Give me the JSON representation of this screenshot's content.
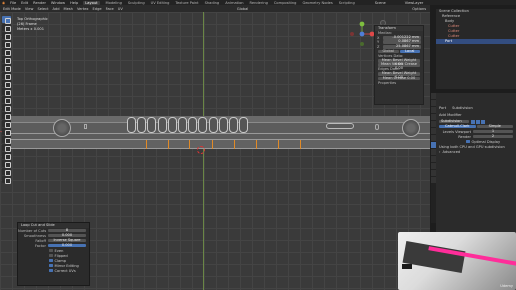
{
  "menubar": {
    "app_icon": "blender-logo-icon",
    "menus": [
      "File",
      "Edit",
      "Render",
      "Window",
      "Help"
    ],
    "workspaces": [
      "Layout",
      "Modeling",
      "Sculpting",
      "UV Editing",
      "Texture Paint",
      "Shading",
      "Animation",
      "Rendering",
      "Compositing",
      "Geometry Nodes",
      "Scripting"
    ],
    "active_workspace": "Layout",
    "scene": "Scene",
    "view_layer": "ViewLayer"
  },
  "header": {
    "mode": "Edit Mode",
    "items": [
      "View",
      "Select",
      "Add",
      "Mesh",
      "Vertex",
      "Edge",
      "Face",
      "UV"
    ],
    "transform": "Global",
    "overlay_label": "Options"
  },
  "viewport": {
    "info_lines": [
      "Top Orthographic",
      "(26) Frame",
      "Meters x 0.001"
    ],
    "gizmo": {
      "x_color": "#e04848",
      "y_color": "#7fbf3f",
      "z_color": "#4f7fd9"
    }
  },
  "npanel": {
    "title": "Transform",
    "section": "Median:",
    "rows": [
      {
        "label": "X",
        "value": "-0.001222 mm"
      },
      {
        "label": "Y",
        "value": "0.0867 mm"
      },
      {
        "label": "Z",
        "value": "25.0867 mm"
      }
    ],
    "space_buttons": [
      "Global",
      "Local"
    ],
    "active_space": "Local",
    "vertices_data": "Vertices Data:",
    "vertex_rows": [
      {
        "label": "Mean Bevel Weight",
        "value": "0.00"
      },
      {
        "label": "Mean Vertex Crease",
        "value": "0.00"
      }
    ],
    "edges_data": "Edges Data:",
    "edge_rows": [
      {
        "label": "Mean Bevel Weight",
        "value": "0.00"
      },
      {
        "label": "Mean Crease",
        "value": "0.00"
      }
    ],
    "properties": "Properties"
  },
  "operator_panel": {
    "title": "Loop Cut and Slide",
    "rows": [
      {
        "label": "Number of Cuts",
        "value": "8",
        "blue": false
      },
      {
        "label": "Smoothness",
        "value": "0.000",
        "blue": false
      },
      {
        "label": "Falloff",
        "value": "Inverse Square",
        "blue": false
      },
      {
        "label": "Factor",
        "value": "0.000",
        "blue": true
      }
    ],
    "checks": [
      {
        "label": "Even",
        "on": false
      },
      {
        "label": "Flipped",
        "on": false
      },
      {
        "label": "Clamp",
        "on": true
      },
      {
        "label": "Mirror Editing",
        "on": true
      },
      {
        "label": "Correct UVs",
        "on": true
      }
    ]
  },
  "outliner": {
    "items": [
      {
        "label": "Scene Collection",
        "selected": false
      },
      {
        "label": "Reference",
        "selected": false
      },
      {
        "label": "Body",
        "selected": false
      },
      {
        "label": "Cutter",
        "selected": false
      },
      {
        "label": "Cutter",
        "selected": false
      },
      {
        "label": "Cutter",
        "selected": false
      },
      {
        "label": "Port",
        "selected": true
      }
    ]
  },
  "properties": {
    "object_label": "Port",
    "modifier_name": "Subdivision",
    "add_modifier": "Add Modifier",
    "subsurf_label": "Subdivision",
    "mode_buttons": [
      "Catmull-Clark",
      "Simple"
    ],
    "active_mode": "Catmull-Clark",
    "levels_viewport_label": "Levels Viewport",
    "levels_viewport": "1",
    "render_label": "Render",
    "render_value": "2",
    "optimal_display": "Optimal Display",
    "gpu_note": "Using both CPU and GPU subdivision",
    "advanced": "Advanced"
  },
  "webcam": {
    "stripe_color": "#ff2d9a",
    "watermark": "Udemy"
  },
  "colors": {
    "accent": "#4772b3",
    "loop_cut": "#e08a27"
  }
}
